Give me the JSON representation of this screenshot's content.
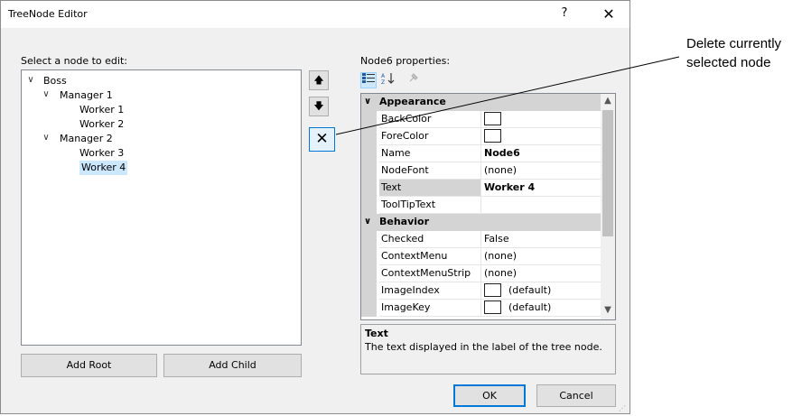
{
  "window": {
    "title": "TreeNode Editor",
    "help_label": "?",
    "close_label": "✕"
  },
  "tree_panel": {
    "label": "Select a node to edit:",
    "nodes": [
      {
        "label": "Boss",
        "level": 0,
        "expanded": true
      },
      {
        "label": "Manager 1",
        "level": 1,
        "expanded": true
      },
      {
        "label": "Worker 1",
        "level": 2
      },
      {
        "label": "Worker 2",
        "level": 2
      },
      {
        "label": "Manager 2",
        "level": 1,
        "expanded": true
      },
      {
        "label": "Worker 3",
        "level": 2
      },
      {
        "label": "Worker 4",
        "level": 2,
        "selected": true
      }
    ],
    "add_root_label": "Add Root",
    "add_child_label": "Add Child"
  },
  "node_buttons": {
    "move_up": "🡅",
    "move_down": "🡇",
    "delete": "✕"
  },
  "properties": {
    "label": "Node6 properties:",
    "toolbar": {
      "categorized_icon": "categorized-icon",
      "alphabetical_icon": "alphabetical-icon",
      "property_pages_icon": "property-pages-icon"
    },
    "categories": [
      {
        "name": "Appearance",
        "rows": [
          {
            "name": "BackColor",
            "value": "",
            "swatch": true
          },
          {
            "name": "ForeColor",
            "value": "",
            "swatch": true
          },
          {
            "name": "Name",
            "value": "Node6",
            "bold": true
          },
          {
            "name": "NodeFont",
            "value": "(none)"
          },
          {
            "name": "Text",
            "value": "Worker 4",
            "bold": true,
            "selected": true
          },
          {
            "name": "ToolTipText",
            "value": ""
          }
        ]
      },
      {
        "name": "Behavior",
        "rows": [
          {
            "name": "Checked",
            "value": "False"
          },
          {
            "name": "ContextMenu",
            "value": "(none)"
          },
          {
            "name": "ContextMenuStrip",
            "value": "(none)"
          },
          {
            "name": "ImageIndex",
            "value": "(default)",
            "swatch": true
          },
          {
            "name": "ImageKey",
            "value": "(default)",
            "swatch": true
          }
        ]
      }
    ],
    "description": {
      "title": "Text",
      "text": "The text displayed in the label of the tree node."
    }
  },
  "footer": {
    "ok_label": "OK",
    "cancel_label": "Cancel"
  },
  "annotation": {
    "line1": "Delete currently",
    "line2": "selected node"
  },
  "colors": {
    "selection": "#cce8ff",
    "accent": "#0078d7",
    "category_bg": "#d4d4d4"
  }
}
